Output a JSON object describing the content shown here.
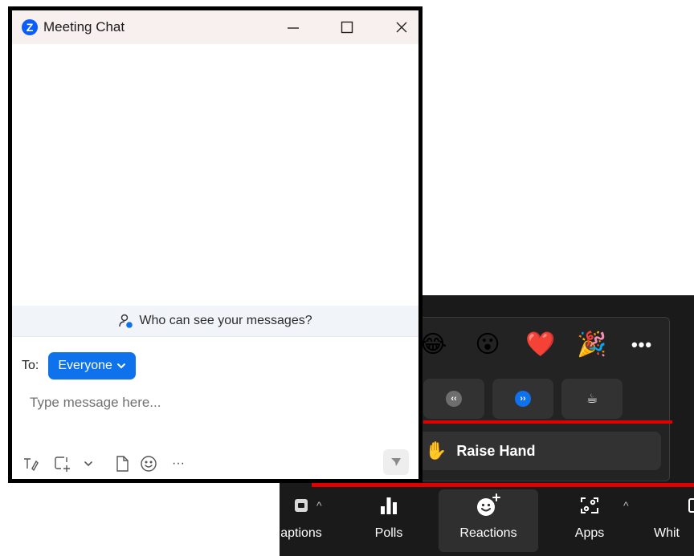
{
  "chat": {
    "title": "Meeting Chat",
    "logo_letter": "Z",
    "visibility_text": "Who can see your messages?",
    "to_label": "To:",
    "recipient": "Everyone",
    "message_placeholder": "Type message here...",
    "more_tools": "···"
  },
  "reactions": {
    "emojis": [
      "😂",
      "😮",
      "❤️",
      "🎉"
    ],
    "more": "•••",
    "speed_buttons": [
      "‹‹",
      "››",
      "☕"
    ],
    "raise_hand_icon": "✋",
    "raise_hand_label": "Raise Hand"
  },
  "toolbar": {
    "captions_label": "aptions",
    "polls_label": "Polls",
    "reactions_label": "Reactions",
    "apps_label": "Apps",
    "whiteboards_label": "Whit"
  },
  "colors": {
    "accent_blue": "#0e72ed",
    "highlight_red": "#e00000",
    "toolbar_bg": "#1a1a1a"
  }
}
